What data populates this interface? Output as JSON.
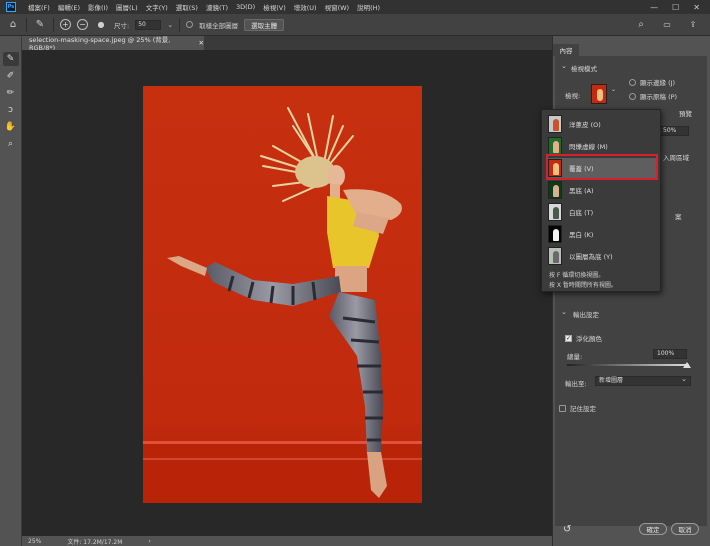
{
  "app": {
    "logo": "Ps"
  },
  "menu": [
    "檔案(F)",
    "編輯(E)",
    "影像(I)",
    "圖層(L)",
    "文字(Y)",
    "選取(S)",
    "濾鏡(T)",
    "3D(D)",
    "檢視(V)",
    "增效(U)",
    "視窗(W)",
    "說明(H)"
  ],
  "window_controls": [
    "—",
    "☐",
    "✕"
  ],
  "options": {
    "size_label": "尺寸:",
    "size_value": "50",
    "sample_all_label": "取樣全部圖層",
    "select_subject": "選取主體"
  },
  "document": {
    "tab_title": "selection-masking-space.jpeg @ 25% (背景, RGB/8*)",
    "close": "✕"
  },
  "status": {
    "zoom": "25%",
    "file_info": "文件: 17.2M/17.2M",
    "arrow": "›"
  },
  "panel": {
    "tab": "內容",
    "view_mode_title": "檢視模式",
    "view_label": "檢視:",
    "show_edge": "顯示邊緣 (J)",
    "show_original": "顯示原稿 (P)",
    "partial_text_1": "預覽",
    "partial_text_2": "50%",
    "partial_text_3": "入周區域",
    "partial_text_4": "案",
    "output_title": "輸出設定",
    "decontaminate": "淨化顏色",
    "amount_label": "總量:",
    "amount_value": "100%",
    "output_to_label": "輸出至:",
    "output_to_value": "新增圖層",
    "remember": "記住設定",
    "ok": "確定",
    "cancel": "取消",
    "reset_icon": "↺"
  },
  "view_menu": {
    "items": [
      {
        "label": "洋蔥皮 (O)",
        "bg": "#c8c8c8",
        "fig": "#c5542f"
      },
      {
        "label": "閃爍虛線 (M)",
        "bg": "#1f6b2a",
        "fig": "#e4b08a"
      },
      {
        "label": "覆蓋 (V)",
        "bg": "#c32a0f",
        "fig": "#f0c080"
      },
      {
        "label": "黑底 (A)",
        "bg": "#0d3a17",
        "fig": "#d8b090"
      },
      {
        "label": "白底 (T)",
        "bg": "#d8d8d8",
        "fig": "#4a5a4a"
      },
      {
        "label": "黑白 (K)",
        "bg": "#050505",
        "fig": "#f5f5f5"
      },
      {
        "label": "以圖層為底 (Y)",
        "bg": "#b8c0b8",
        "fig": "#6a6a6a"
      }
    ],
    "selected_index": 2,
    "hint_1": "按 F 循環切換視圖。",
    "hint_2": "按 X 暫時關閉所有視圖。"
  }
}
